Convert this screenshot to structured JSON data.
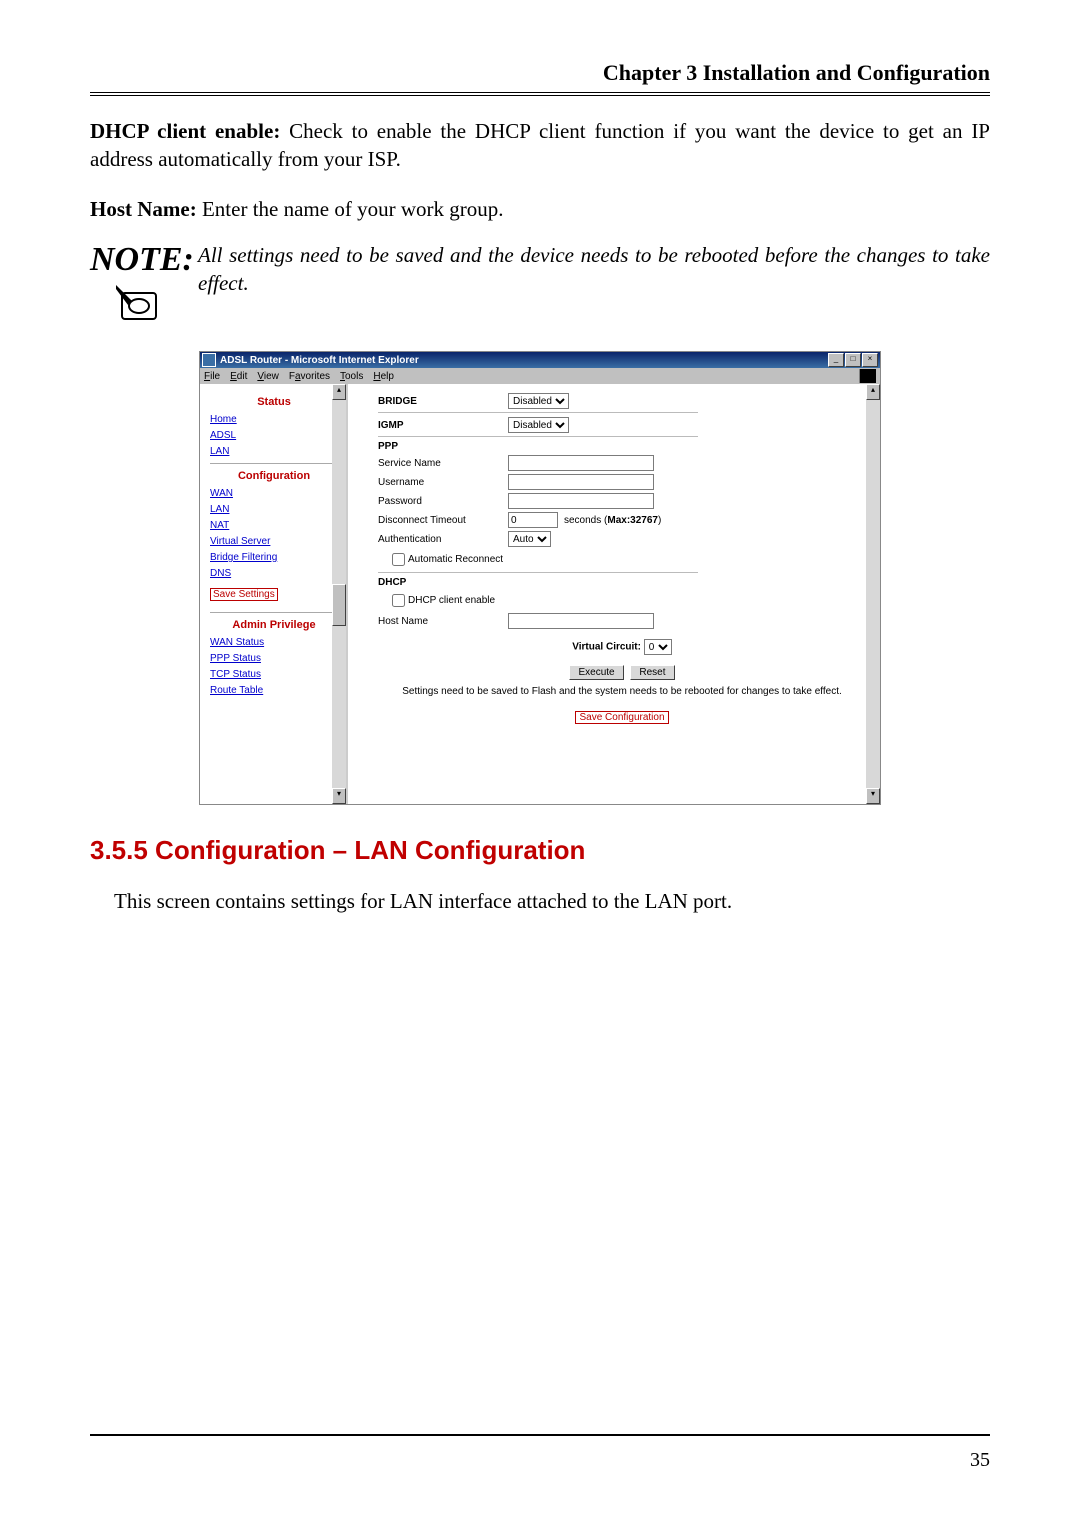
{
  "chapter_header": "Chapter 3 Installation and Configuration",
  "para1_label": "DHCP client enable:",
  "para1_body": " Check to enable the DHCP client function if you want the device to get an IP address automatically from your ISP.",
  "para2_label": "Host Name:",
  "para2_body": " Enter the name of your work group.",
  "note_icon_text": "NOTE:",
  "note_body": "All settings need to be saved and the device needs to be rebooted before the changes to take effect.",
  "browser": {
    "title": "ADSL Router - Microsoft Internet Explorer",
    "menus": [
      "File",
      "Edit",
      "View",
      "Favorites",
      "Tools",
      "Help"
    ],
    "sidebar": {
      "status_title": "Status",
      "status_links": [
        "Home",
        "ADSL",
        "LAN"
      ],
      "config_title": "Configuration",
      "config_links": [
        "WAN",
        "LAN",
        "NAT",
        "Virtual Server",
        "Bridge Filtering",
        "DNS"
      ],
      "save_settings": "Save Settings",
      "admin_title": "Admin Privilege",
      "admin_links": [
        "WAN Status",
        "PPP Status",
        "TCP Status",
        "Route Table"
      ]
    },
    "main": {
      "bridge_label": "BRIDGE",
      "bridge_value": "Disabled",
      "igmp_label": "IGMP",
      "igmp_value": "Disabled",
      "ppp_label": "PPP",
      "service_name_label": "Service Name",
      "username_label": "Username",
      "password_label": "Password",
      "disconnect_label": "Disconnect Timeout",
      "disconnect_value": "0",
      "disconnect_after_a": "seconds (",
      "disconnect_after_bold": "Max:32767",
      "disconnect_after_b": ")",
      "auth_label": "Authentication",
      "auth_value": "Auto",
      "auto_reconnect_label": "Automatic Reconnect",
      "dhcp_label": "DHCP",
      "dhcp_client_label": "DHCP client enable",
      "hostname_label": "Host Name",
      "vc_label": "Virtual Circuit:",
      "vc_value": "0",
      "execute_btn": "Execute",
      "reset_btn": "Reset",
      "caption": "Settings need to be saved to Flash and the system needs to be rebooted for changes to take effect.",
      "save_config": "Save Configuration"
    }
  },
  "section_heading": "3.5.5 Configuration – LAN Configuration",
  "section_body": "This screen contains settings for LAN interface attached to the LAN port.",
  "page_number": "35"
}
